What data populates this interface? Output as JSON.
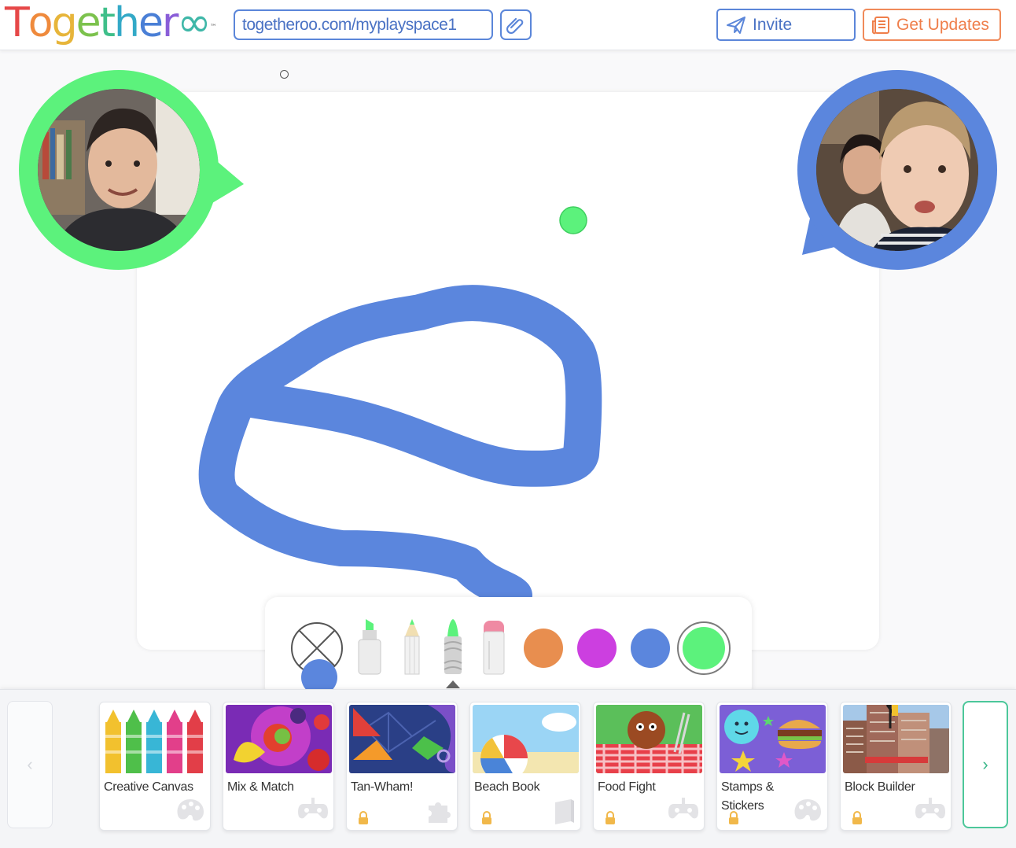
{
  "header": {
    "logo": {
      "letters": [
        "T",
        "o",
        "g",
        "e",
        "t",
        "h",
        "e",
        "r",
        "∞"
      ],
      "trademark": "™"
    },
    "url": "togetheroo.com/myplayspace1",
    "invite_label": "Invite",
    "updates_label": "Get Updates"
  },
  "toolbar": {
    "tools": [
      "eraser",
      "marker",
      "pencil",
      "crayon",
      "chalk"
    ],
    "selected_tool": "crayon",
    "current_color": "#5b86dd",
    "colors": [
      "#e88e4f",
      "#cc3fe0",
      "#5b86dd",
      "#5cf27c"
    ],
    "selected_color": "#5cf27c"
  },
  "games": [
    {
      "name": "Creative Canvas",
      "locked": false,
      "category": "palette-icon"
    },
    {
      "name": "Mix & Match",
      "locked": false,
      "category": "gamepad-icon"
    },
    {
      "name": "Tan-Wham!",
      "locked": true,
      "category": "puzzle-icon"
    },
    {
      "name": "Beach Book",
      "locked": true,
      "category": "book-icon"
    },
    {
      "name": "Food Fight",
      "locked": true,
      "category": "gamepad-icon"
    },
    {
      "name": "Stamps & Stickers",
      "locked": true,
      "category": "palette-icon"
    },
    {
      "name": "Block Builder",
      "locked": true,
      "category": "gamepad-icon"
    }
  ],
  "nav": {
    "prev": "‹",
    "next": "›"
  },
  "colors": {
    "accent_blue": "#5b86d9",
    "accent_orange": "#ef7e4a",
    "accent_green": "#4cc79a",
    "bubble_green": "#5cf27c",
    "stroke_blue": "#5b86dd"
  }
}
